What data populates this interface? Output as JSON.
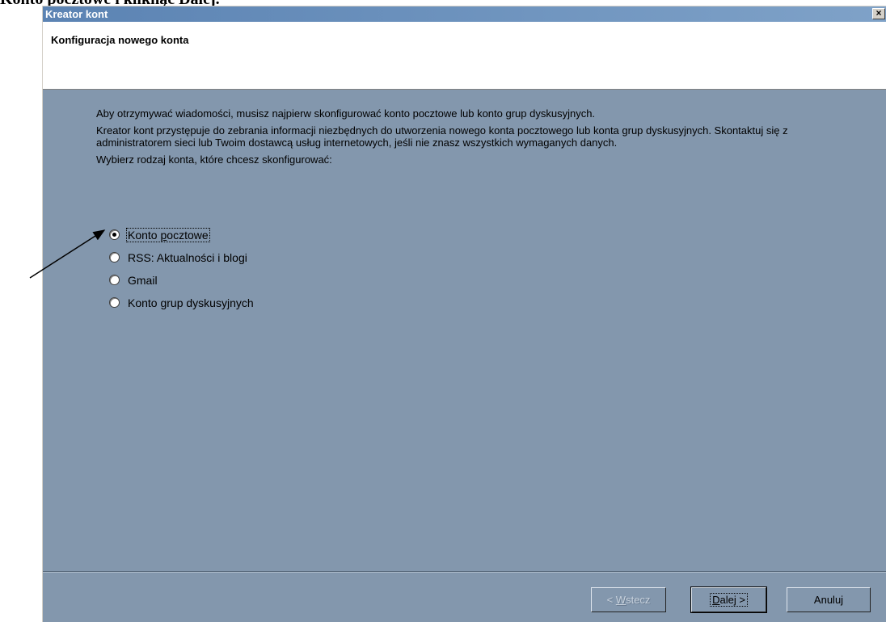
{
  "doc_heading": "Konto pocztowe i kliknąć Dalej.",
  "window": {
    "title": "Kreator kont",
    "close_glyph": "×"
  },
  "header": {
    "title": "Konfiguracja nowego konta"
  },
  "body": {
    "intro": "Aby otrzymywać wiadomości, musisz najpierw skonfigurować konto pocztowe lub konto grup dyskusyjnych.",
    "info": "Kreator kont przystępuje do zebrania informacji niezbędnych do utworzenia nowego konta pocztowego lub konta grup dyskusyjnych. Skontaktuj się z administratorem sieci lub Twoim dostawcą usług internetowych, jeśli nie znasz wszystkich wymaganych danych.",
    "prompt": "Wybierz rodzaj konta, które chcesz skonfigurować:"
  },
  "options": [
    {
      "prefix": "Konto ",
      "accel": "p",
      "suffix": "ocztowe",
      "checked": true
    },
    {
      "prefix": "RSS: Aktualności i blogi",
      "accel": "",
      "suffix": "",
      "checked": false
    },
    {
      "prefix": "Gmail",
      "accel": "",
      "suffix": "",
      "checked": false
    },
    {
      "prefix": "Konto grup dyskusyjnych",
      "accel": "",
      "suffix": "",
      "checked": false
    }
  ],
  "buttons": {
    "back": {
      "prefix": "< ",
      "accel": "W",
      "suffix": "stecz",
      "enabled": false
    },
    "next": {
      "prefix": "",
      "accel": "D",
      "suffix": "alej >",
      "enabled": true
    },
    "cancel": {
      "label": "Anuluj",
      "enabled": true
    }
  }
}
